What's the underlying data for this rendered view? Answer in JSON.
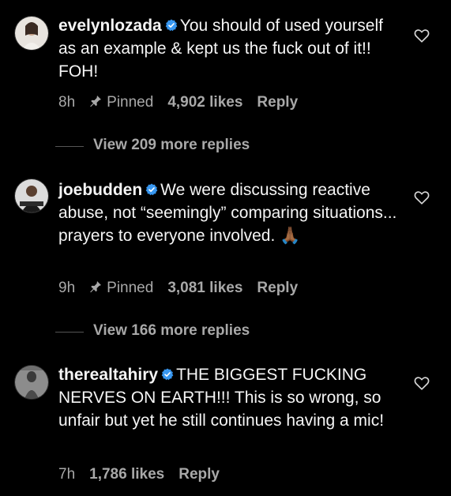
{
  "comments": [
    {
      "username": "evelynlozada",
      "text": "You should of used yourself as an example & kept us the fuck out of it!! FOH!",
      "time": "8h",
      "pinned_label": "Pinned",
      "likes": "4,902 likes",
      "reply_label": "Reply",
      "view_more": "View 209 more replies"
    },
    {
      "username": "joebudden",
      "text": "We were discussing reactive abuse, not “seemingly” comparing situations... prayers to everyone involved.",
      "emoji": "🙏🏾",
      "time": "9h",
      "pinned_label": "Pinned",
      "likes": "3,081 likes",
      "reply_label": "Reply",
      "view_more": "View 166 more replies"
    },
    {
      "username": "therealtahiry",
      "text": "THE BIGGEST FUCKING NERVES ON EARTH!!! This is so wrong, so unfair but yet he still continues having a mic!",
      "time": "7h",
      "likes": "1,786 likes",
      "reply_label": "Reply"
    }
  ],
  "colors": {
    "background": "#000000",
    "text": "#f5f5f5",
    "secondary": "#a8a8a8",
    "verified": "#3897f0"
  },
  "icons": [
    "verified-badge-icon",
    "pin-icon",
    "heart-icon"
  ]
}
